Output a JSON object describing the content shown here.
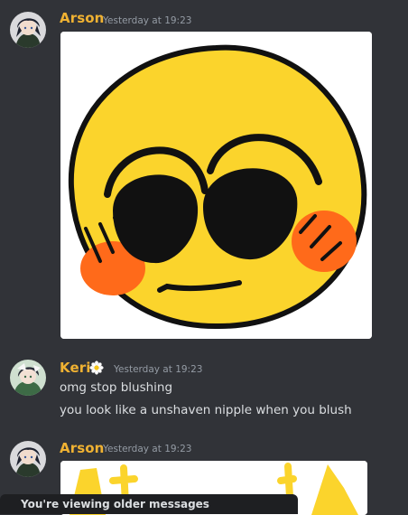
{
  "messages": [
    {
      "username": "Arson",
      "timestamp": "Yesterday at 19:23",
      "attachment": "blushing-cursed-emoji-image"
    },
    {
      "username": "Keri",
      "timestamp": "Yesterday at 19:23",
      "role_icon": "daisy-icon",
      "lines": [
        "omg stop blushing",
        "you look like a unshaven nipple when you blush"
      ]
    },
    {
      "username": "Arson",
      "timestamp": "Yesterday at 19:23",
      "attachment": "partial-image"
    }
  ],
  "banner": {
    "text": "You're viewing older messages"
  },
  "colors": {
    "background": "#313338",
    "username": "#f0b232",
    "timestamp": "#949ba4",
    "message_text": "#dbdee1",
    "banner_bg": "#1e1f22"
  }
}
